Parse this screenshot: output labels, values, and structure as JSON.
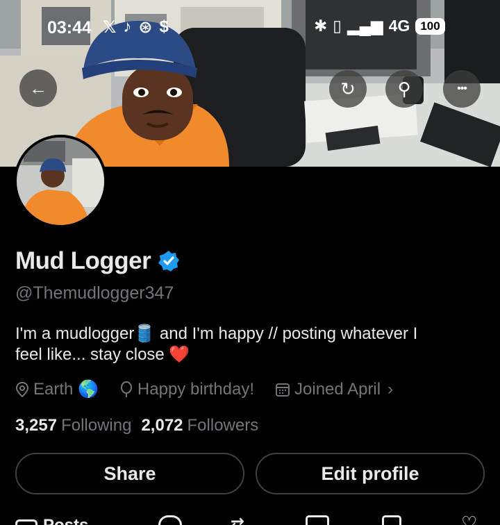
{
  "status_bar": {
    "time": "03:44",
    "left_icons": [
      "x-logo-icon",
      "tiktok-icon",
      "app-icon",
      "cash-icon"
    ],
    "network": "4G",
    "battery": "100"
  },
  "header": {
    "back_icon": "arrow-left-icon",
    "right_icons": [
      "refresh-icon",
      "search-icon",
      "more-icon"
    ],
    "glyphs": {
      "back": "←",
      "search": "⚲",
      "more": "•••",
      "refresh": "↻"
    }
  },
  "profile": {
    "display_name": "Mud Logger",
    "verified": true,
    "handle": "@Themudlogger347",
    "bio_line1": "I'm a mudlogger🛢️ and I'm happy // posting whatever I",
    "bio_line2": "feel like... stay close ❤️",
    "location": "Earth 🌎",
    "birthday": "Happy birthday!",
    "joined": "Joined April",
    "following_count": "3,257",
    "following_label": "Following",
    "followers_count": "2,072",
    "followers_label": "Followers"
  },
  "actions": {
    "share_label": "Share",
    "edit_label": "Edit profile"
  },
  "tabs": {
    "posts_label": "Posts"
  },
  "colors": {
    "background": "#000000",
    "verified_blue": "#1d9bf0",
    "muted": "#71767b",
    "border": "#3e4144"
  }
}
